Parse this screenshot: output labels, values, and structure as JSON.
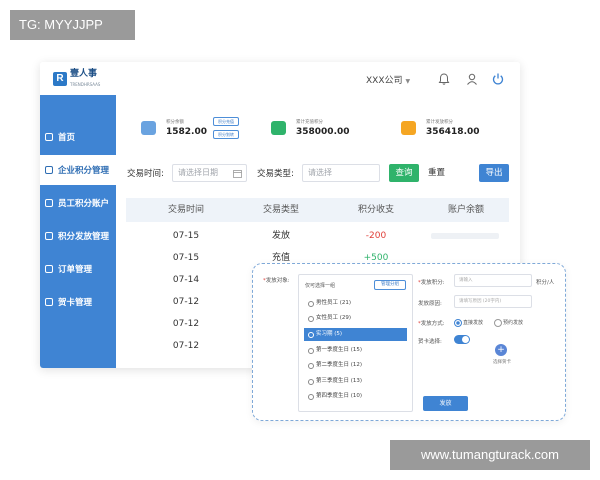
{
  "tags": {
    "top_left": "TG: MYYJJPP",
    "bottom_right": "www.tumangturack.com"
  },
  "header": {
    "logo_mark": "R",
    "logo_title": "壹人事",
    "logo_sub": "TRENDHRSAAS",
    "company": "XXX公司",
    "caret": "▼"
  },
  "sidebar": {
    "items": [
      {
        "label": "首页",
        "icon": "home-icon"
      },
      {
        "label": "企业积分管理",
        "icon": "building-icon",
        "active": true
      },
      {
        "label": "员工积分账户",
        "icon": "account-icon"
      },
      {
        "label": "积分发放管理",
        "icon": "distribute-icon"
      },
      {
        "label": "订单管理",
        "icon": "order-icon"
      },
      {
        "label": "贺卡管理",
        "icon": "card-icon"
      }
    ]
  },
  "stats": [
    {
      "label": "积分余额",
      "value": "1582.00",
      "color": "#4a90d9"
    },
    {
      "label": "累计充值积分",
      "value": "358000.00",
      "color": "#2fb36b"
    },
    {
      "label": "累计发放积分",
      "value": "356418.00",
      "color": "#f5a623"
    }
  ],
  "stat_buttons": {
    "recharge": "积分充值",
    "transfer": "积分划转"
  },
  "filters": {
    "date_label": "交易时间:",
    "date_placeholder": "请选择日期",
    "type_label": "交易类型:",
    "type_placeholder": "请选择",
    "query": "查询",
    "reset": "重置",
    "export": "导出"
  },
  "table": {
    "headers": [
      "交易时间",
      "交易类型",
      "积分收支",
      "账户余额"
    ],
    "rows": [
      {
        "date": "07-15",
        "type": "发放",
        "amount": "-200"
      },
      {
        "date": "07-15",
        "type": "充值",
        "amount": "+500"
      },
      {
        "date": "07-14",
        "type": "",
        "amount": ""
      },
      {
        "date": "07-12",
        "type": "",
        "amount": ""
      },
      {
        "date": "07-12",
        "type": "",
        "amount": ""
      },
      {
        "date": "07-12",
        "type": "",
        "amount": ""
      }
    ]
  },
  "dialog": {
    "target_label": "发放对象:",
    "picker_head": "仅可选择一组",
    "picker_manage": "管理分组",
    "groups": [
      {
        "label": "男性员工 (21)"
      },
      {
        "label": "女性员工 (29)"
      },
      {
        "label": "实习期 (5)",
        "selected": true
      },
      {
        "label": "第一季度生日 (15)"
      },
      {
        "label": "第二季度生日 (12)"
      },
      {
        "label": "第三季度生日 (13)"
      },
      {
        "label": "第四季度生日 (10)"
      }
    ],
    "points_label": "发放积分:",
    "points_placeholder": "请输入",
    "points_unit": "积分/人",
    "reason_label": "发放原因:",
    "reason_placeholder": "请填写原因 (20字内)",
    "method_label": "发放方式:",
    "method_direct": "直接发放",
    "method_scheduled": "预约发放",
    "card_label": "贺卡选择:",
    "card_select": "选择贺卡",
    "plus": "+",
    "send": "发放"
  }
}
